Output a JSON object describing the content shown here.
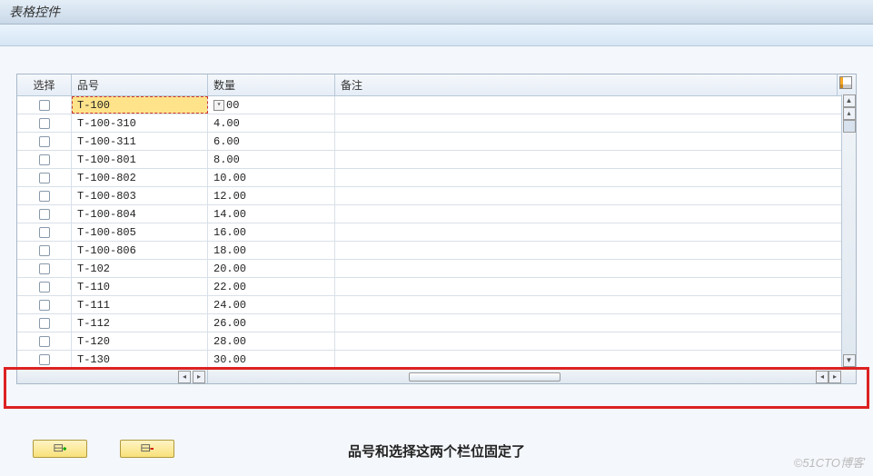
{
  "app_title": "表格控件",
  "columns": {
    "select": "选择",
    "item": "品号",
    "qty": "数量",
    "note": "备注"
  },
  "active_row_index": 0,
  "active_qty_suffix": "00",
  "rows": [
    {
      "item": "T-100",
      "qty": ""
    },
    {
      "item": "T-100-310",
      "qty": "4.00"
    },
    {
      "item": "T-100-311",
      "qty": "6.00"
    },
    {
      "item": "T-100-801",
      "qty": "8.00"
    },
    {
      "item": "T-100-802",
      "qty": "10.00"
    },
    {
      "item": "T-100-803",
      "qty": "12.00"
    },
    {
      "item": "T-100-804",
      "qty": "14.00"
    },
    {
      "item": "T-100-805",
      "qty": "16.00"
    },
    {
      "item": "T-100-806",
      "qty": "18.00"
    },
    {
      "item": "T-102",
      "qty": "20.00"
    },
    {
      "item": "T-110",
      "qty": "22.00"
    },
    {
      "item": "T-111",
      "qty": "24.00"
    },
    {
      "item": "T-112",
      "qty": "26.00"
    },
    {
      "item": "T-120",
      "qty": "28.00"
    },
    {
      "item": "T-130",
      "qty": "30.00"
    }
  ],
  "caption": "品号和选择这两个栏位固定了",
  "watermark": "©51CTO博客"
}
